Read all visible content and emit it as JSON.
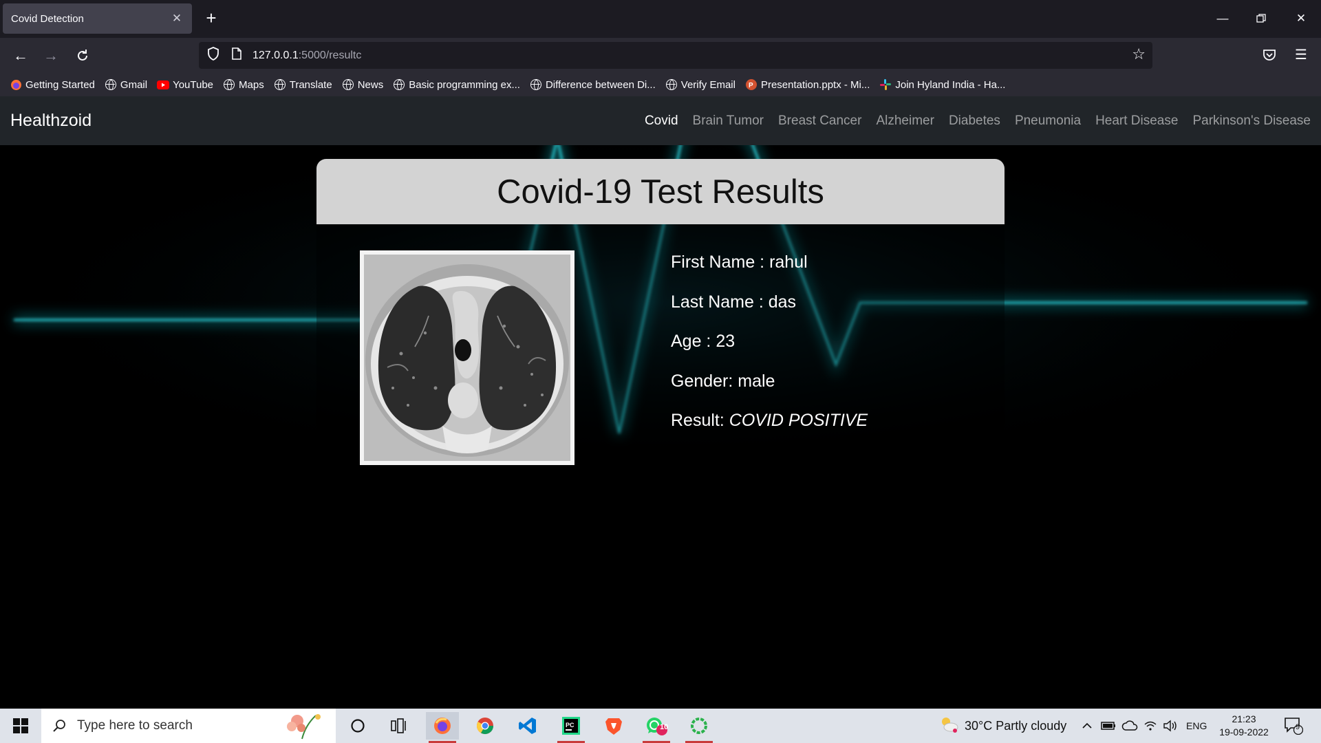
{
  "browser": {
    "tab_title": "Covid Detection",
    "url_host": "127.0.0.1",
    "url_path": ":5000/resultc",
    "bookmarks": [
      {
        "label": "Getting Started",
        "icon": "firefox-icon"
      },
      {
        "label": "Gmail",
        "icon": "globe-icon"
      },
      {
        "label": "YouTube",
        "icon": "youtube-icon"
      },
      {
        "label": "Maps",
        "icon": "globe-icon"
      },
      {
        "label": "Translate",
        "icon": "globe-icon"
      },
      {
        "label": "News",
        "icon": "globe-icon"
      },
      {
        "label": "Basic programming ex...",
        "icon": "globe-icon"
      },
      {
        "label": "Difference between Di...",
        "icon": "globe-icon"
      },
      {
        "label": "Verify Email",
        "icon": "globe-icon"
      },
      {
        "label": "Presentation.pptx - Mi...",
        "icon": "powerpoint-icon"
      },
      {
        "label": "Join Hyland India - Ha...",
        "icon": "slack-icon"
      }
    ]
  },
  "site": {
    "brand": "Healthzoid",
    "nav": [
      {
        "label": "Covid",
        "active": true
      },
      {
        "label": "Brain Tumor"
      },
      {
        "label": "Breast Cancer"
      },
      {
        "label": "Alzheimer"
      },
      {
        "label": "Diabetes"
      },
      {
        "label": "Pneumonia"
      },
      {
        "label": "Heart Disease"
      },
      {
        "label": "Parkinson's Disease"
      }
    ]
  },
  "result": {
    "title": "Covid-19 Test Results",
    "first_name": "First Name : rahul",
    "last_name": "Last Name : das",
    "age": "Age : 23",
    "gender": "Gender: male",
    "result_label": "Result: ",
    "result_value": "COVID POSITIVE"
  },
  "taskbar": {
    "search_placeholder": "Type here to search",
    "weather": "30°C  Partly cloudy",
    "language": "ENG",
    "time": "21:23",
    "date": "19-09-2022",
    "notifications": "9",
    "whatsapp_badge": "10"
  },
  "colors": {
    "glow": "#19d4e0",
    "chrome_dark": "#1c1b22",
    "chrome": "#2b2a33",
    "site_nav": "#212529",
    "card_header": "#d3d3d3"
  }
}
